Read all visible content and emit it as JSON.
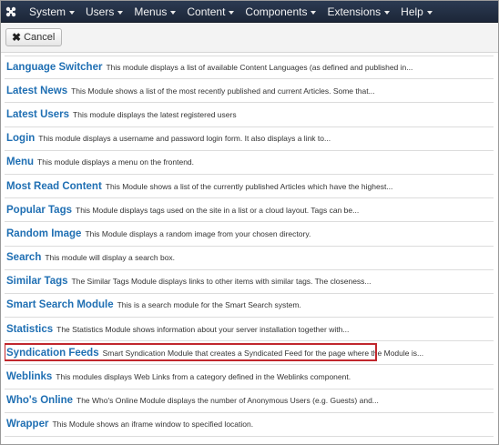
{
  "nav": {
    "items": [
      {
        "label": "System"
      },
      {
        "label": "Users"
      },
      {
        "label": "Menus"
      },
      {
        "label": "Content"
      },
      {
        "label": "Components"
      },
      {
        "label": "Extensions"
      },
      {
        "label": "Help"
      }
    ],
    "logo_icon": "joomla-logo-icon"
  },
  "toolbar": {
    "cancel_label": "Cancel",
    "cancel_icon": "close-icon"
  },
  "modules": [
    {
      "title": "Language Switcher",
      "desc": "This module displays a list of available Content Languages (as defined and published in..."
    },
    {
      "title": "Latest News",
      "desc": "This Module shows a list of the most recently published and current Articles. Some that..."
    },
    {
      "title": "Latest Users",
      "desc": "This module displays the latest registered users"
    },
    {
      "title": "Login",
      "desc": "This module displays a username and password login form. It also displays a link to..."
    },
    {
      "title": "Menu",
      "desc": "This module displays a menu on the frontend."
    },
    {
      "title": "Most Read Content",
      "desc": "This Module shows a list of the currently published Articles which have the highest..."
    },
    {
      "title": "Popular Tags",
      "desc": "This Module displays tags used on the site in a list or a cloud layout. Tags can be..."
    },
    {
      "title": "Random Image",
      "desc": "This Module displays a random image from your chosen directory."
    },
    {
      "title": "Search",
      "desc": "This module will display a search box."
    },
    {
      "title": "Similar Tags",
      "desc": "The Similar Tags Module displays links to other items with similar tags. The closeness..."
    },
    {
      "title": "Smart Search Module",
      "desc": "This is a search module for the Smart Search system."
    },
    {
      "title": "Statistics",
      "desc": "The Statistics Module shows information about your server installation together with..."
    },
    {
      "title": "Syndication Feeds",
      "desc": "Smart Syndication Module that creates a Syndicated Feed for the page where the Module is..."
    },
    {
      "title": "Weblinks",
      "desc": "This modules displays Web Links from a category defined in the Weblinks component."
    },
    {
      "title": "Who's Online",
      "desc": "The Who's Online Module displays the number of Anonymous Users (e.g. Guests) and..."
    },
    {
      "title": "Wrapper",
      "desc": "This Module shows an iframe window to specified location."
    }
  ],
  "colors": {
    "nav_bg": "#1c2638",
    "link": "#1f6fb3",
    "highlight": "#c1272d"
  }
}
